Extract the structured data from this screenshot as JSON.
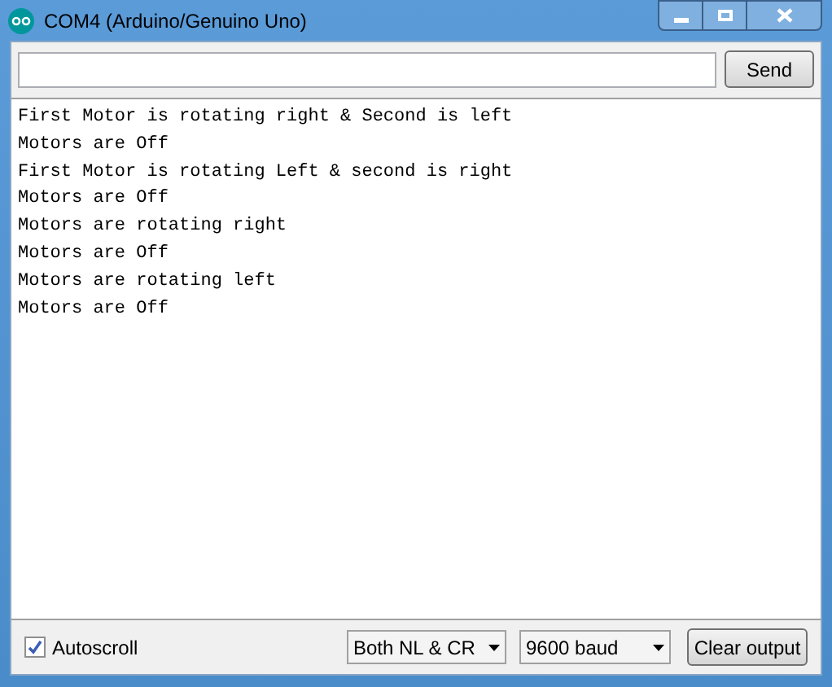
{
  "window": {
    "title": "COM4 (Arduino/Genuino Uno)"
  },
  "send_button": "Send",
  "output_lines": [
    "First Motor is rotating right & Second is left",
    "Motors are Off",
    "First Motor is rotating Left & second is right",
    "Motors are Off",
    "Motors are rotating right",
    "Motors are Off",
    "Motors are rotating left",
    "Motors are Off"
  ],
  "autoscroll": {
    "label": "Autoscroll",
    "checked": true
  },
  "line_ending": {
    "value": "Both NL & CR"
  },
  "baud_rate": {
    "value": "9600 baud"
  },
  "clear_button": "Clear output"
}
